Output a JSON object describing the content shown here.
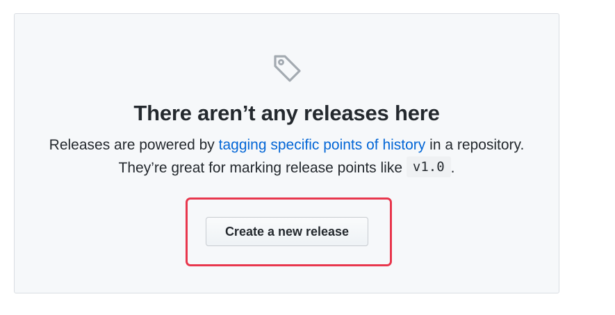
{
  "blankslate": {
    "title": "There aren’t any releases here",
    "description_before_link": "Releases are powered by ",
    "link_text": "tagging specific points of history",
    "description_after_link": " in a repository. They’re great for marking release points like ",
    "code_example": "v1.0",
    "description_end": ".",
    "create_button_label": "Create a new release",
    "icon": "tag-icon"
  },
  "colors": {
    "link": "#0366d6",
    "highlight_border": "#e8374d",
    "panel_background": "#f6f8fa"
  }
}
